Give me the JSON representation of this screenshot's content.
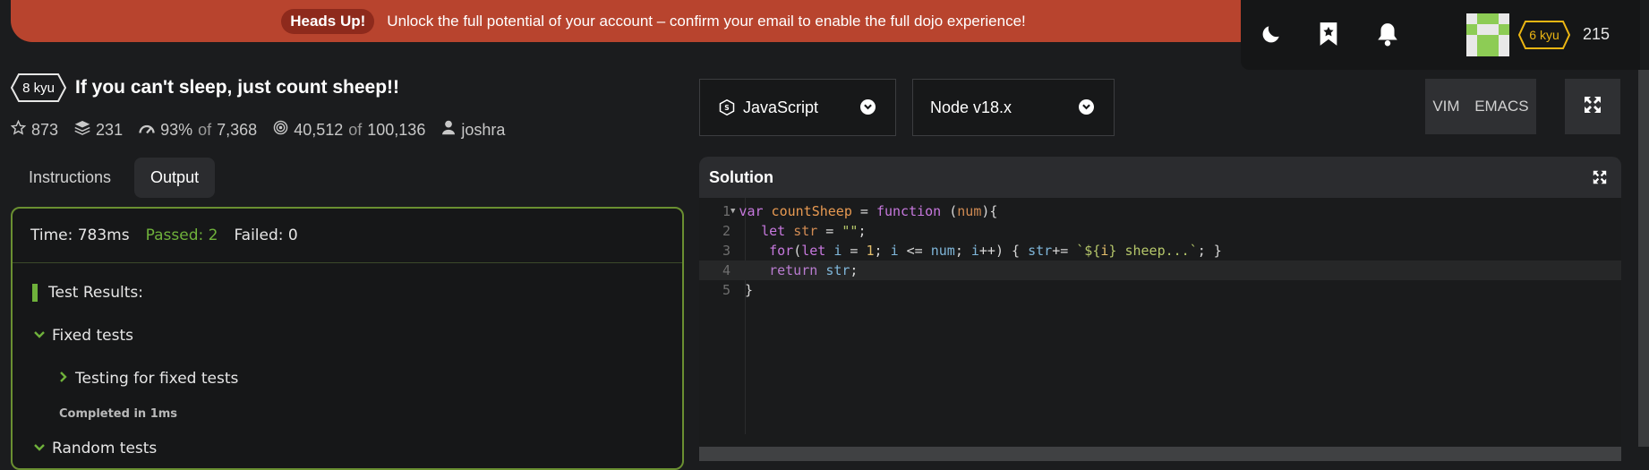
{
  "banner": {
    "pill": "Heads Up!",
    "message": "Unlock the full potential of your account – confirm your email to enable the full dojo experience!"
  },
  "topbar": {
    "icons": [
      "moon-icon",
      "bookmark-icon",
      "bell-icon",
      "avatar",
      "rank-badge"
    ],
    "rank": "6 kyu",
    "honor": "215"
  },
  "kata": {
    "rank": "8 kyu",
    "title": "If you can't sleep, just count sheep!!",
    "stars": "873",
    "collections": "231",
    "satisfaction_pct": "93%",
    "satisfaction_of": "of",
    "satisfaction_votes": "7,368",
    "completed": "40,512",
    "completed_of": "of",
    "attempted": "100,136",
    "author": "joshra"
  },
  "tabs": [
    {
      "label": "Instructions",
      "active": false
    },
    {
      "label": "Output",
      "active": true
    }
  ],
  "output": {
    "time": "Time: 783ms",
    "passed": "Passed: 2",
    "failed": "Failed: 0",
    "results_title": "Test Results:",
    "fixed_tests": "Fixed tests",
    "testing_fixed": "Testing for fixed tests",
    "completed_in": "Completed in 1ms",
    "random_tests": "Random tests"
  },
  "editor": {
    "language": "JavaScript",
    "runtime": "Node v18.x",
    "mode_vim": "VIM",
    "mode_emacs": "EMACS",
    "panel_title": "Solution",
    "line_numbers": [
      "1",
      "2",
      "3",
      "4",
      "5"
    ]
  },
  "colors": {
    "banner": "#b8442e",
    "accent_green": "#6fb13b",
    "rank_yellow": "#ecb613"
  }
}
